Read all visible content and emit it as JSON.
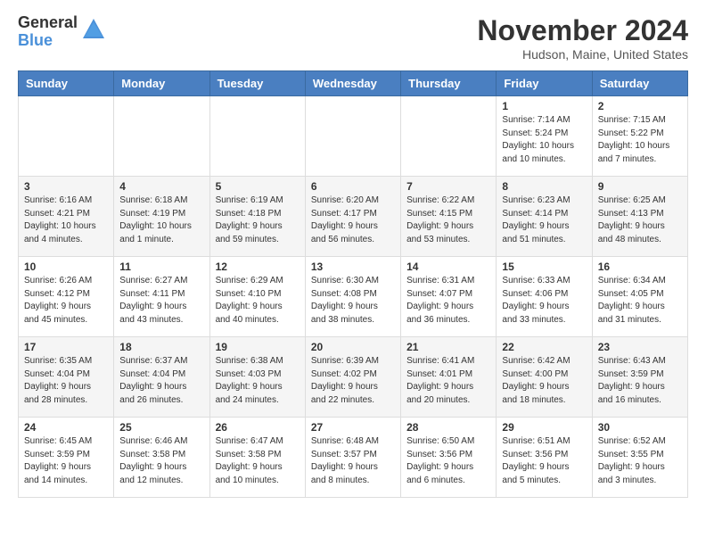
{
  "logo": {
    "general": "General",
    "blue": "Blue"
  },
  "title": "November 2024",
  "location": "Hudson, Maine, United States",
  "days_of_week": [
    "Sunday",
    "Monday",
    "Tuesday",
    "Wednesday",
    "Thursday",
    "Friday",
    "Saturday"
  ],
  "weeks": [
    [
      {
        "day": "",
        "info": ""
      },
      {
        "day": "",
        "info": ""
      },
      {
        "day": "",
        "info": ""
      },
      {
        "day": "",
        "info": ""
      },
      {
        "day": "",
        "info": ""
      },
      {
        "day": "1",
        "info": "Sunrise: 7:14 AM\nSunset: 5:24 PM\nDaylight: 10 hours\nand 10 minutes."
      },
      {
        "day": "2",
        "info": "Sunrise: 7:15 AM\nSunset: 5:22 PM\nDaylight: 10 hours\nand 7 minutes."
      }
    ],
    [
      {
        "day": "3",
        "info": "Sunrise: 6:16 AM\nSunset: 4:21 PM\nDaylight: 10 hours\nand 4 minutes."
      },
      {
        "day": "4",
        "info": "Sunrise: 6:18 AM\nSunset: 4:19 PM\nDaylight: 10 hours\nand 1 minute."
      },
      {
        "day": "5",
        "info": "Sunrise: 6:19 AM\nSunset: 4:18 PM\nDaylight: 9 hours\nand 59 minutes."
      },
      {
        "day": "6",
        "info": "Sunrise: 6:20 AM\nSunset: 4:17 PM\nDaylight: 9 hours\nand 56 minutes."
      },
      {
        "day": "7",
        "info": "Sunrise: 6:22 AM\nSunset: 4:15 PM\nDaylight: 9 hours\nand 53 minutes."
      },
      {
        "day": "8",
        "info": "Sunrise: 6:23 AM\nSunset: 4:14 PM\nDaylight: 9 hours\nand 51 minutes."
      },
      {
        "day": "9",
        "info": "Sunrise: 6:25 AM\nSunset: 4:13 PM\nDaylight: 9 hours\nand 48 minutes."
      }
    ],
    [
      {
        "day": "10",
        "info": "Sunrise: 6:26 AM\nSunset: 4:12 PM\nDaylight: 9 hours\nand 45 minutes."
      },
      {
        "day": "11",
        "info": "Sunrise: 6:27 AM\nSunset: 4:11 PM\nDaylight: 9 hours\nand 43 minutes."
      },
      {
        "day": "12",
        "info": "Sunrise: 6:29 AM\nSunset: 4:10 PM\nDaylight: 9 hours\nand 40 minutes."
      },
      {
        "day": "13",
        "info": "Sunrise: 6:30 AM\nSunset: 4:08 PM\nDaylight: 9 hours\nand 38 minutes."
      },
      {
        "day": "14",
        "info": "Sunrise: 6:31 AM\nSunset: 4:07 PM\nDaylight: 9 hours\nand 36 minutes."
      },
      {
        "day": "15",
        "info": "Sunrise: 6:33 AM\nSunset: 4:06 PM\nDaylight: 9 hours\nand 33 minutes."
      },
      {
        "day": "16",
        "info": "Sunrise: 6:34 AM\nSunset: 4:05 PM\nDaylight: 9 hours\nand 31 minutes."
      }
    ],
    [
      {
        "day": "17",
        "info": "Sunrise: 6:35 AM\nSunset: 4:04 PM\nDaylight: 9 hours\nand 28 minutes."
      },
      {
        "day": "18",
        "info": "Sunrise: 6:37 AM\nSunset: 4:04 PM\nDaylight: 9 hours\nand 26 minutes."
      },
      {
        "day": "19",
        "info": "Sunrise: 6:38 AM\nSunset: 4:03 PM\nDaylight: 9 hours\nand 24 minutes."
      },
      {
        "day": "20",
        "info": "Sunrise: 6:39 AM\nSunset: 4:02 PM\nDaylight: 9 hours\nand 22 minutes."
      },
      {
        "day": "21",
        "info": "Sunrise: 6:41 AM\nSunset: 4:01 PM\nDaylight: 9 hours\nand 20 minutes."
      },
      {
        "day": "22",
        "info": "Sunrise: 6:42 AM\nSunset: 4:00 PM\nDaylight: 9 hours\nand 18 minutes."
      },
      {
        "day": "23",
        "info": "Sunrise: 6:43 AM\nSunset: 3:59 PM\nDaylight: 9 hours\nand 16 minutes."
      }
    ],
    [
      {
        "day": "24",
        "info": "Sunrise: 6:45 AM\nSunset: 3:59 PM\nDaylight: 9 hours\nand 14 minutes."
      },
      {
        "day": "25",
        "info": "Sunrise: 6:46 AM\nSunset: 3:58 PM\nDaylight: 9 hours\nand 12 minutes."
      },
      {
        "day": "26",
        "info": "Sunrise: 6:47 AM\nSunset: 3:58 PM\nDaylight: 9 hours\nand 10 minutes."
      },
      {
        "day": "27",
        "info": "Sunrise: 6:48 AM\nSunset: 3:57 PM\nDaylight: 9 hours\nand 8 minutes."
      },
      {
        "day": "28",
        "info": "Sunrise: 6:50 AM\nSunset: 3:56 PM\nDaylight: 9 hours\nand 6 minutes."
      },
      {
        "day": "29",
        "info": "Sunrise: 6:51 AM\nSunset: 3:56 PM\nDaylight: 9 hours\nand 5 minutes."
      },
      {
        "day": "30",
        "info": "Sunrise: 6:52 AM\nSunset: 3:55 PM\nDaylight: 9 hours\nand 3 minutes."
      }
    ]
  ]
}
